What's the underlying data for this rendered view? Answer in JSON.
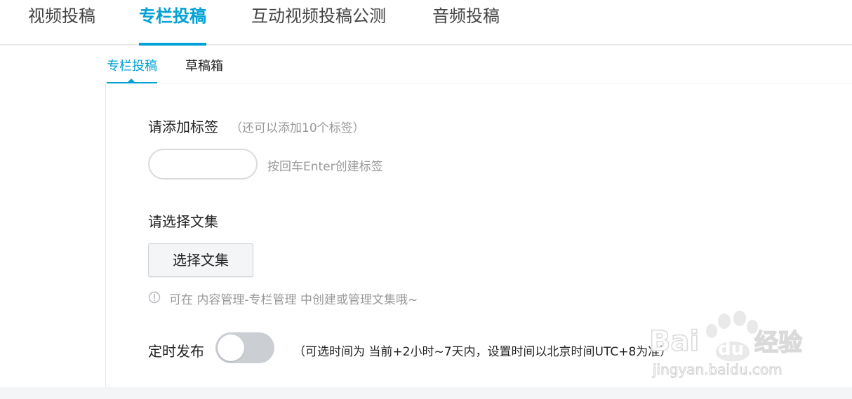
{
  "top_tabs": [
    {
      "label": "视频投稿"
    },
    {
      "label": "专栏投稿"
    },
    {
      "label": "互动视频投稿公测"
    },
    {
      "label": "音频投稿"
    }
  ],
  "sub_tabs": [
    {
      "label": "专栏投稿"
    },
    {
      "label": "草稿箱"
    }
  ],
  "tags": {
    "label": "请添加标签",
    "remaining_hint": "（还可以添加10个标签）",
    "input_value": "",
    "input_hint": "按回车Enter创建标签"
  },
  "collection": {
    "label": "请选择文集",
    "button_label": "选择文集",
    "info_text": "可在 内容管理-专栏管理 中创建或管理文集哦~"
  },
  "schedule": {
    "label": "定时发布",
    "toggle_on": false,
    "hint": "（可选时间为 当前+2小时~7天内，设置时间以北京时间UTC+8为准）"
  },
  "watermark": {
    "logo_text": "Bai",
    "logo_text_2": "du",
    "brand_cn": "经验",
    "url": "jingyan.baidu.com"
  },
  "colors": {
    "accent": "#00a1d6",
    "toggle_off": "#cbcfd4"
  }
}
